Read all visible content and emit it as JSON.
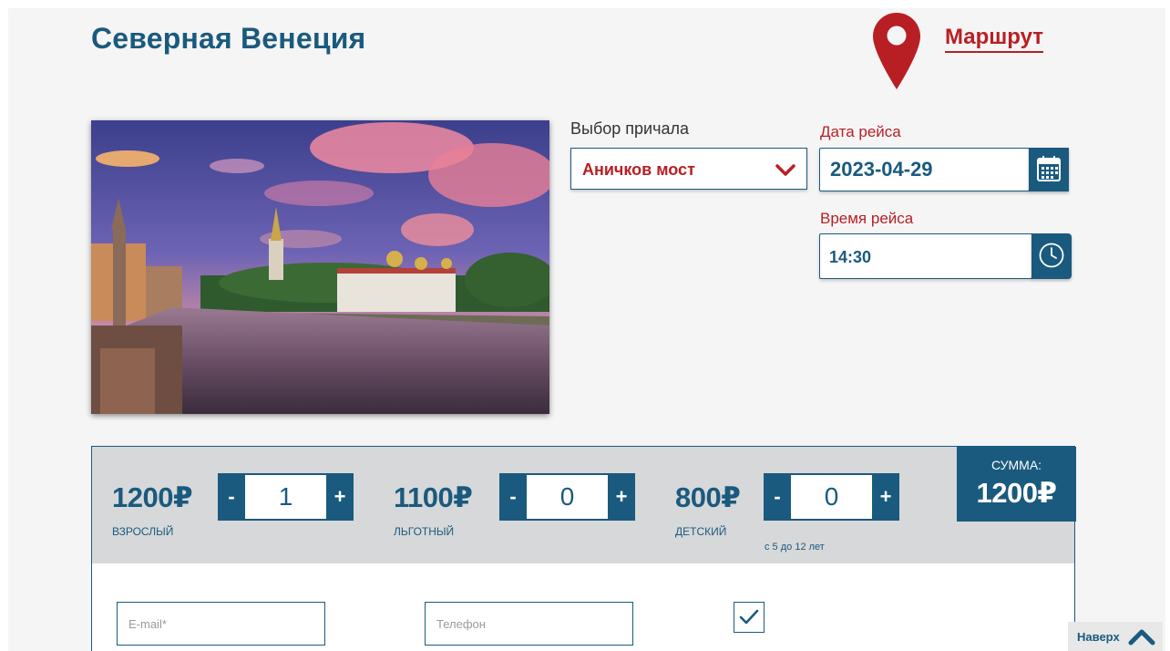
{
  "header": {
    "title": "Северная Венеция",
    "route_link": "Маршрут",
    "pin_icon": "map-pin-icon",
    "pin_color": "#b81f24"
  },
  "booking": {
    "pier": {
      "label": "Выбор причала",
      "value": "Аничков мост",
      "icon": "chevron-down-icon"
    },
    "date": {
      "label": "Дата рейса",
      "value": "2023-04-29",
      "icon": "calendar-icon"
    },
    "time": {
      "label": "Время рейса",
      "value": "14:30",
      "icon": "clock-icon"
    }
  },
  "tickets": [
    {
      "price": "1200₽",
      "type": "взрослый",
      "quantity": "1",
      "note": ""
    },
    {
      "price": "1100₽",
      "type": "льготный",
      "quantity": "0",
      "note": ""
    },
    {
      "price": "800₽",
      "type": "детский",
      "quantity": "0",
      "note": "с 5 до 12 лет"
    }
  ],
  "stepper": {
    "minus": "-",
    "plus": "+"
  },
  "sum": {
    "label": "СУММА:",
    "value": "1200₽"
  },
  "form": {
    "email_placeholder": "E-mail*",
    "phone_placeholder": "Телефон",
    "checkbox_checked": true
  },
  "back_to_top": {
    "label": "Наверх",
    "icon": "chevron-up-icon"
  },
  "colors": {
    "primary": "#1a5a7e",
    "accent": "#b81f24",
    "panel": "#d7d8d9"
  }
}
